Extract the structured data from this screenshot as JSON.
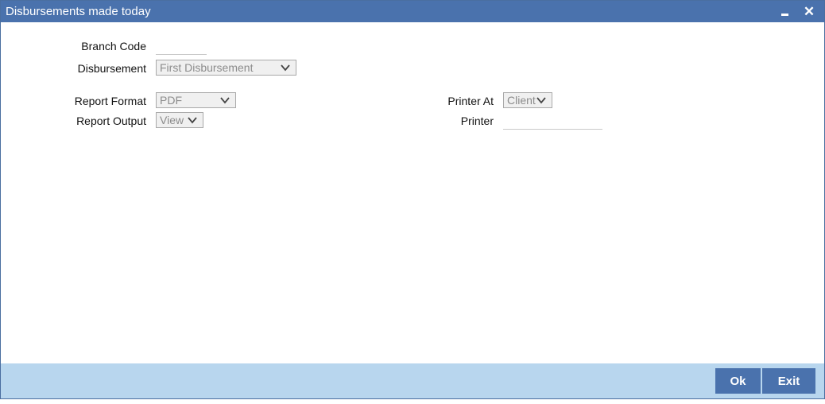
{
  "window": {
    "title": "Disbursements made today",
    "minimize_icon": "minimize-icon",
    "close_icon": "close-icon"
  },
  "form": {
    "branch_code": {
      "label": "Branch Code",
      "value": ""
    },
    "disbursement": {
      "label": "Disbursement",
      "value": "First Disbursement"
    },
    "report_format": {
      "label": "Report Format",
      "value": "PDF"
    },
    "report_output": {
      "label": "Report Output",
      "value": "View"
    },
    "printer_at": {
      "label": "Printer At",
      "value": "Client"
    },
    "printer": {
      "label": "Printer",
      "value": ""
    }
  },
  "footer": {
    "ok_label": "Ok",
    "exit_label": "Exit"
  },
  "colors": {
    "titlebar": "#4a72ad",
    "footer": "#b8d6ee",
    "button": "#4a72ad"
  }
}
